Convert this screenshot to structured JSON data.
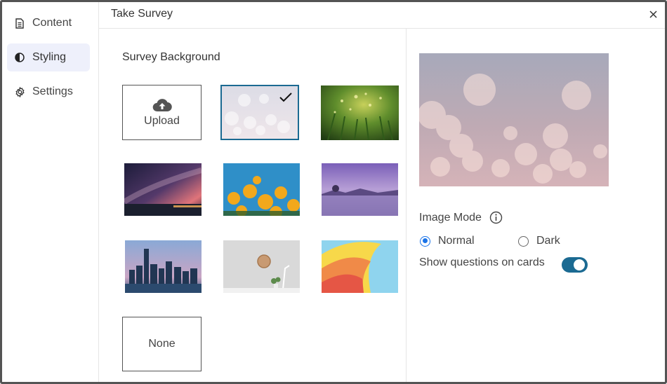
{
  "sidebar": {
    "items": [
      {
        "label": "Content",
        "icon": "document-icon",
        "active": false
      },
      {
        "label": "Styling",
        "icon": "contrast-icon",
        "active": true
      },
      {
        "label": "Settings",
        "icon": "gear-icon",
        "active": false
      }
    ]
  },
  "header": {
    "title": "Take Survey",
    "close_icon": "close-icon"
  },
  "backgrounds": {
    "section_title": "Survey Background",
    "upload_label": "Upload",
    "none_label": "None",
    "images": [
      {
        "name": "bokeh",
        "selected": true
      },
      {
        "name": "grass-dew",
        "selected": false
      },
      {
        "name": "milky-way",
        "selected": false
      },
      {
        "name": "yellow-flowers",
        "selected": false
      },
      {
        "name": "purple-lake",
        "selected": false
      },
      {
        "name": "city-skyline",
        "selected": false
      },
      {
        "name": "wall-clock-room",
        "selected": false
      },
      {
        "name": "paper-curl",
        "selected": false
      }
    ]
  },
  "options": {
    "image_mode_label": "Image Mode",
    "modes": [
      {
        "label": "Normal",
        "checked": true
      },
      {
        "label": "Dark",
        "checked": false
      }
    ],
    "show_questions_label": "Show questions on cards",
    "show_questions_enabled": true
  },
  "colors": {
    "accent": "#1b6a92",
    "radio": "#1a73e8",
    "active_nav": "#eef0fb"
  }
}
